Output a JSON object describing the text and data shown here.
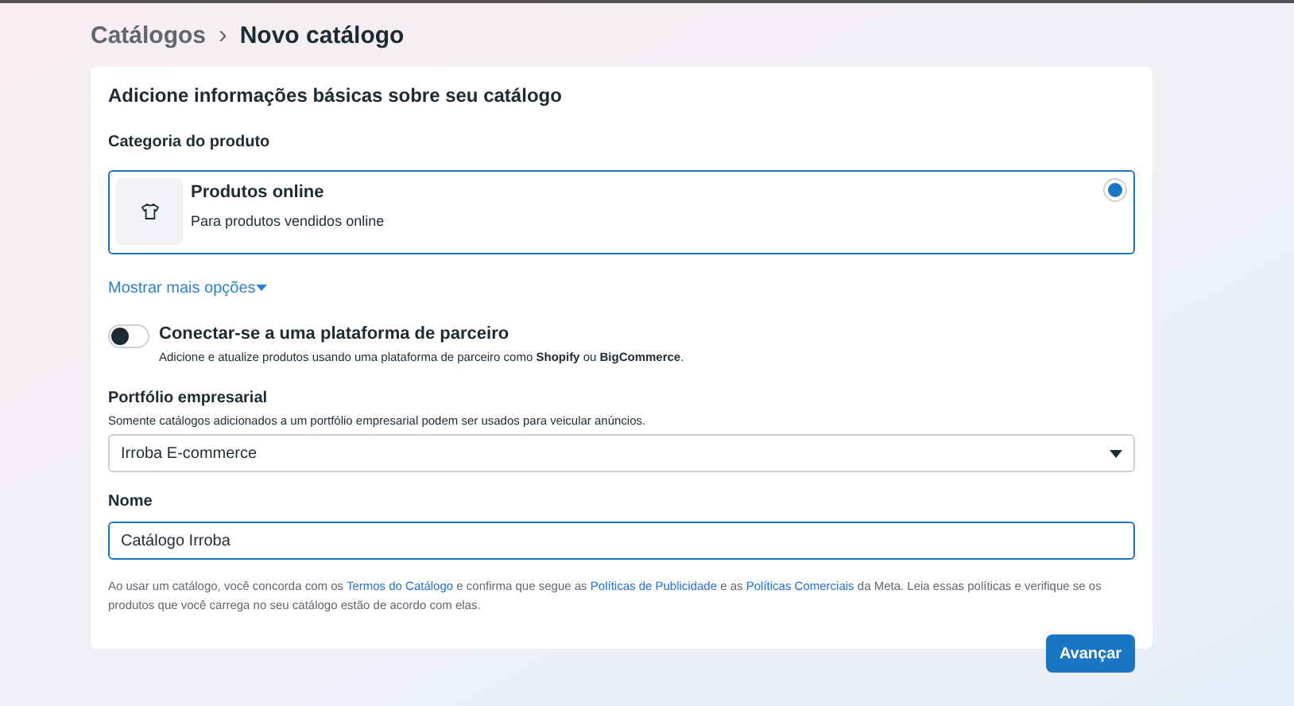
{
  "breadcrumb": {
    "parent": "Catálogos",
    "separator": "›",
    "current": "Novo catálogo"
  },
  "form": {
    "heading": "Adicione informações básicas sobre seu catálogo",
    "category_label": "Categoria do produto",
    "categories": [
      {
        "title": "Produtos online",
        "description": "Para produtos vendidos online",
        "selected": true
      }
    ],
    "more_options": "Mostrar mais opções",
    "partner": {
      "title": "Conectar-se a uma plataforma de parceiro",
      "description": "Adicione e atualize produtos usando uma plataforma de parceiro como **Shopify** ou **BigCommerce**.",
      "on": false
    },
    "portfolio": {
      "label": "Portfólio empresarial",
      "hint": "Somente catálogos adicionados a um portfólio empresarial podem ser usados para veicular anúncios.",
      "value": "Irroba E-commerce"
    },
    "name": {
      "label": "Nome",
      "value": "Catálogo Irroba"
    },
    "terms": [
      {
        "kind": "text",
        "text": "Ao usar um catálogo, você concorda com os "
      },
      {
        "kind": "link",
        "text": "Termos do Catálogo"
      },
      {
        "kind": "text",
        "text": " e confirma que segue as "
      },
      {
        "kind": "link",
        "text": "Políticas de Publicidade"
      },
      {
        "kind": "text",
        "text": " e as "
      },
      {
        "kind": "link",
        "text": "Políticas Comerciais"
      },
      {
        "kind": "text",
        "text": " da Meta. Leia essas políticas e verifique se os produtos que você carrega no seu catálogo estão de acordo com elas."
      }
    ],
    "submit": "Avançar"
  }
}
